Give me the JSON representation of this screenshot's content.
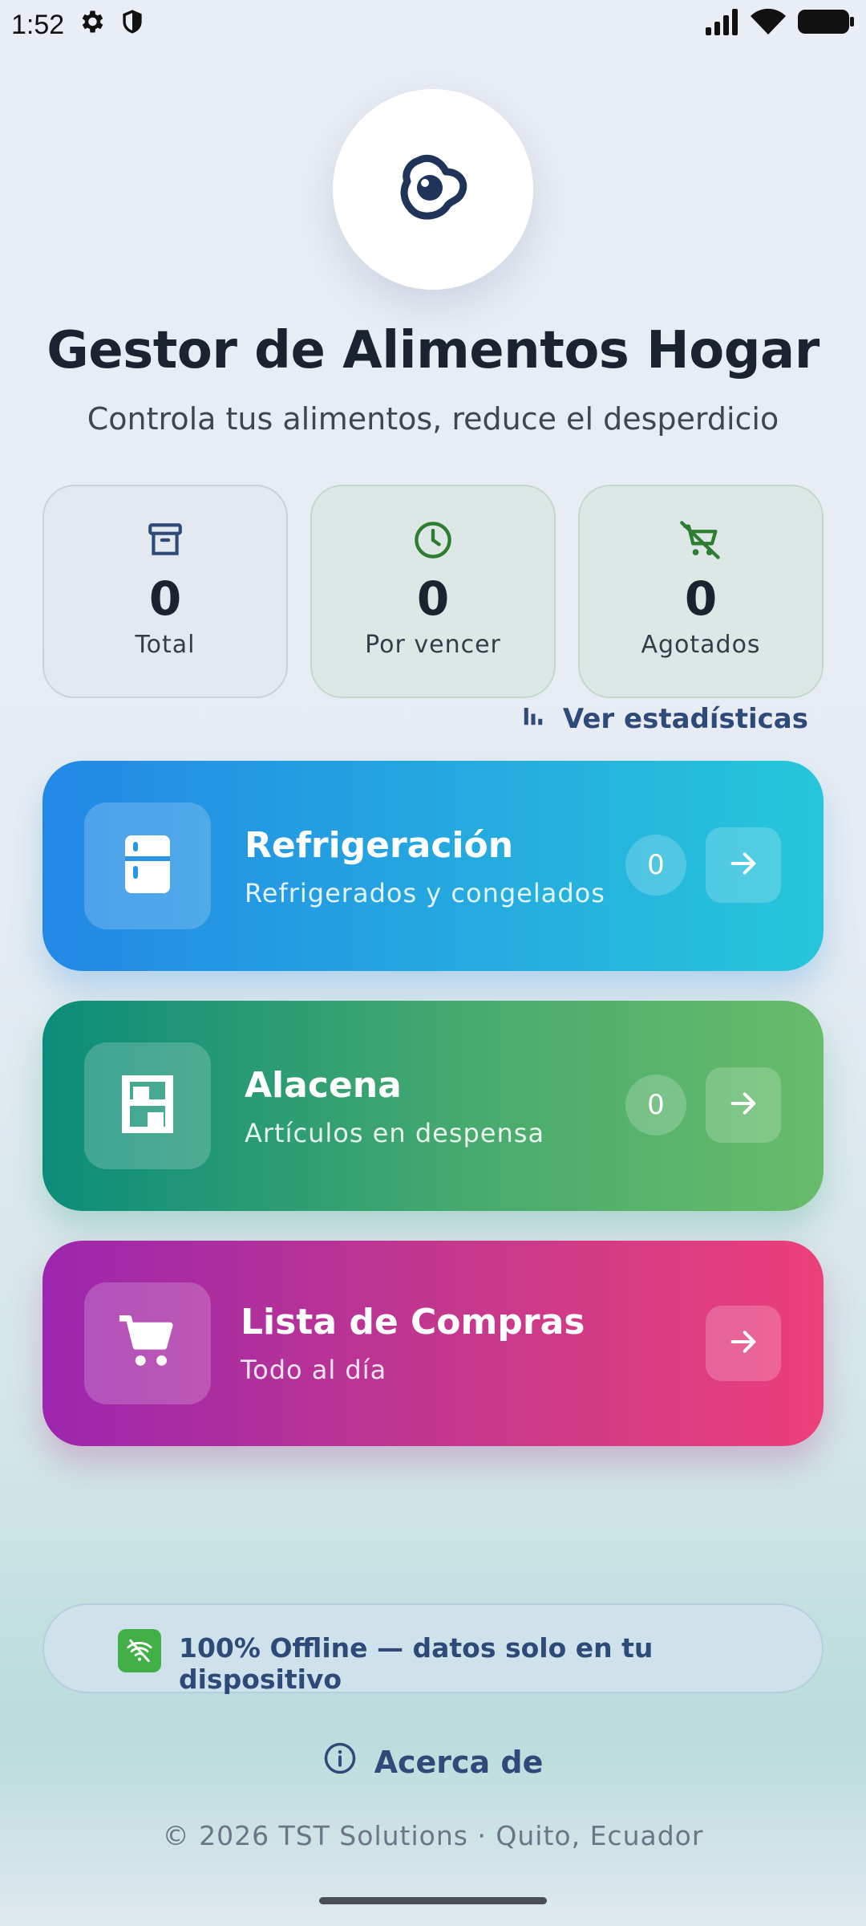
{
  "status_bar": {
    "time": "1:52",
    "icons": [
      "gear-icon",
      "shield-icon",
      "signal-icon",
      "wifi-icon",
      "battery-icon"
    ]
  },
  "app": {
    "logo_icon": "egg-icon",
    "title": "Gestor de Alimentos Hogar",
    "subtitle": "Controla tus alimentos, reduce el desperdicio"
  },
  "stats": [
    {
      "icon": "archive-box-icon",
      "value": "0",
      "label": "Total",
      "color": "#2e4a78"
    },
    {
      "icon": "clock-icon",
      "value": "0",
      "label": "Por vencer",
      "color": "#2e7d32"
    },
    {
      "icon": "cart-off-icon",
      "value": "0",
      "label": "Agotados",
      "color": "#2e7d32"
    }
  ],
  "stats_link": {
    "icon": "bar-chart-icon",
    "label": "Ver estadísticas"
  },
  "sections": {
    "fridge": {
      "icon": "fridge-icon",
      "title": "Refrigeración",
      "subtitle": "Refrigerados y congelados",
      "count": "0"
    },
    "pantry": {
      "icon": "shelf-icon",
      "title": "Alacena",
      "subtitle": "Artículos en despensa",
      "count": "0"
    },
    "shopping": {
      "icon": "cart-icon",
      "title": "Lista de Compras",
      "subtitle": "Todo al día"
    }
  },
  "offline_banner": {
    "icon": "wifi-off-icon",
    "text": "100% Offline — datos solo en tu dispositivo"
  },
  "about": {
    "icon": "info-icon",
    "label": "Acerca de"
  },
  "footer": "© 2026 TST Solutions · Quito, Ecuador",
  "colors": {
    "navy": "#2e4a78",
    "fridge_gradient": [
      "#2388e6",
      "#26c6da"
    ],
    "pantry_gradient": [
      "#0b8c7a",
      "#68bc6a"
    ],
    "shopping_gradient": [
      "#9c26ae",
      "#ec407a"
    ],
    "offline_green": "#43b047"
  }
}
